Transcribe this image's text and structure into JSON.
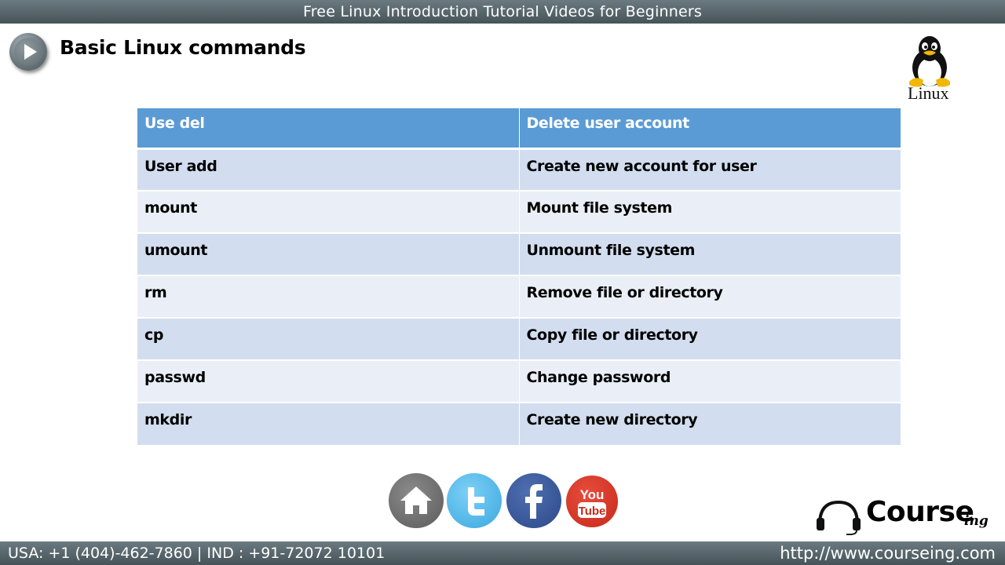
{
  "header": {
    "banner_title": "Free Linux Introduction Tutorial Videos for Beginners",
    "page_title": "Basic Linux commands",
    "logo_text": "Linux"
  },
  "table": {
    "header": [
      "Use del",
      "Delete user account"
    ],
    "rows": [
      [
        "User add",
        "Create new account for user"
      ],
      [
        "mount",
        "Mount file system"
      ],
      [
        "umount",
        "Unmount file system"
      ],
      [
        "rm",
        "Remove file or directory"
      ],
      [
        "cp",
        "Copy file or directory"
      ],
      [
        "passwd",
        "Change password"
      ],
      [
        "mkdir",
        "Create new directory"
      ]
    ]
  },
  "social": {
    "icons": [
      "home-icon",
      "twitter-icon",
      "facebook-icon",
      "youtube-icon"
    ],
    "youtube_text": [
      "You",
      "Tube"
    ]
  },
  "brand": {
    "name": "Course",
    "suffix": "ing"
  },
  "footer": {
    "contact": "USA: +1 (404)-462-7860  | IND : +91-72072 10101",
    "website": "http://www.courseing.com"
  },
  "colors": {
    "banner": "#56646a",
    "table_header": "#5b9bd5",
    "row_odd": "#d2deef",
    "row_even": "#eaeff7"
  }
}
